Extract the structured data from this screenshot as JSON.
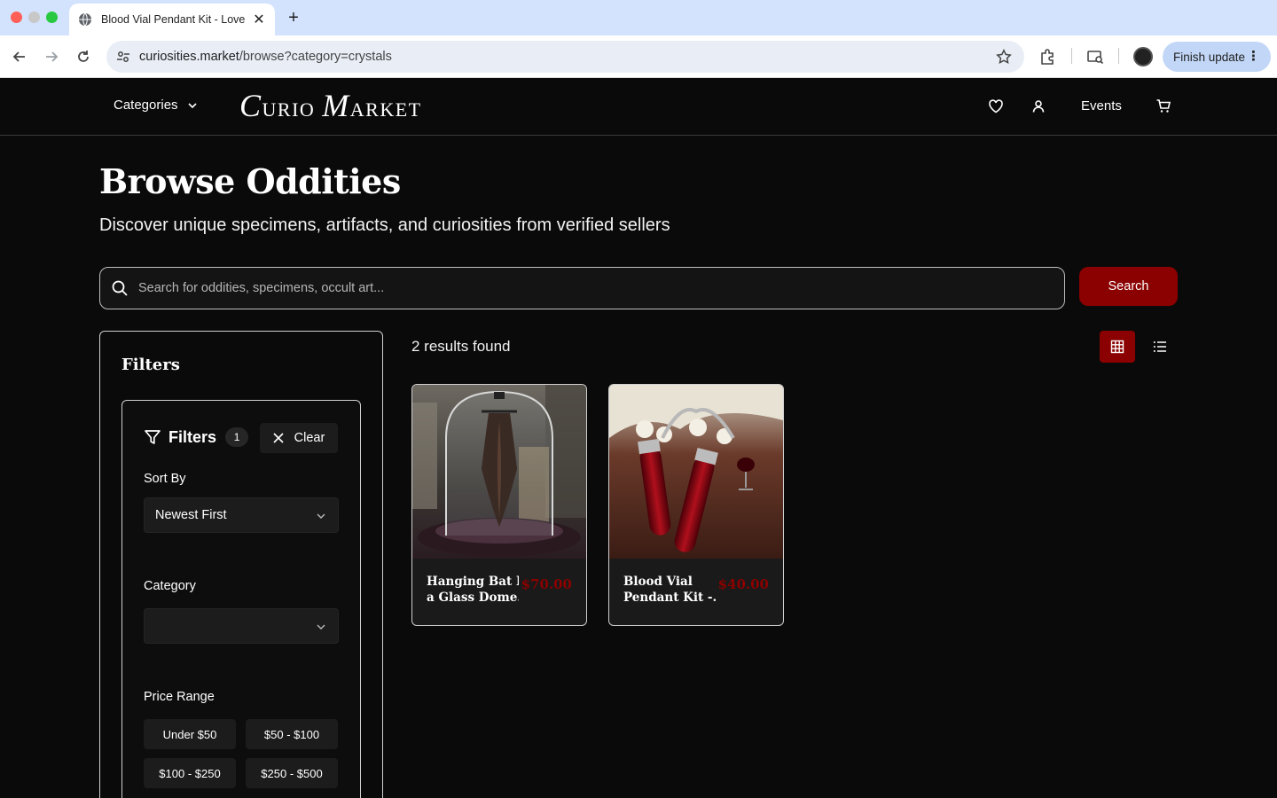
{
  "browser": {
    "tab_title": "Blood Vial Pendant Kit - Love",
    "url_domain": "curiosities.market",
    "url_path": "/browse?category=crystals",
    "finish_update_label": "Finish update"
  },
  "header": {
    "categories_label": "Categories",
    "logo_first_initial": "C",
    "logo_first_rest": "URIO",
    "logo_second_initial": "M",
    "logo_second_rest": "ARKET",
    "events_label": "Events"
  },
  "hero": {
    "title": "Browse Oddities",
    "subtitle": "Discover unique specimens, artifacts, and curiosities from verified sellers"
  },
  "search": {
    "placeholder": "Search for oddities, specimens, occult art...",
    "button_label": "Search"
  },
  "filters": {
    "heading": "Filters",
    "inner_label": "Filters",
    "active_count": "1",
    "clear_label": "Clear",
    "sort_label": "Sort By",
    "sort_value": "Newest First",
    "category_label": "Category",
    "category_value": "",
    "price_label": "Price Range",
    "price_options": [
      "Under $50",
      "$50 - $100",
      "$100 - $250",
      "$250 - $500"
    ]
  },
  "results": {
    "count_text": "2 results found",
    "items": [
      {
        "title_line1": "Hanging Bat In",
        "title_line2": "a Glass Dome...",
        "price": "$70.00"
      },
      {
        "title_line1": "Blood Vial",
        "title_line2": "Pendant Kit -...",
        "price": "$40.00"
      }
    ]
  },
  "colors": {
    "accent": "#8b0000",
    "background": "#0a0a0a",
    "browser_tabbar": "#d3e3fd"
  }
}
